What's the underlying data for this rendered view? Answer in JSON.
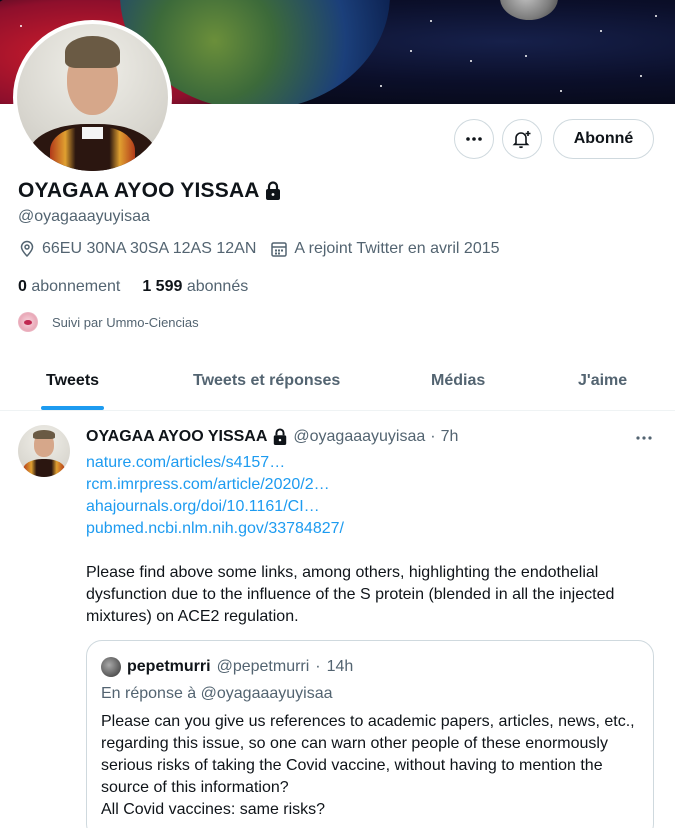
{
  "profile": {
    "name": "OYAGAA AYOO YISSAA",
    "handle": "@oyagaaayuyisaa",
    "location": "66EU 30NA 30SA 12AS 12AN",
    "joined": "A rejoint Twitter en avril 2015",
    "following_count": "0",
    "following_label": "abonnement",
    "followers_count": "1 599",
    "followers_label": "abonnés",
    "followed_by": "Suivi par Ummo-Ciencias"
  },
  "actions": {
    "more_icon": "more-horizontal-icon",
    "notify_icon": "bell-plus-icon",
    "follow_label": "Abonné"
  },
  "tabs": [
    {
      "label": "Tweets"
    },
    {
      "label": "Tweets et réponses"
    },
    {
      "label": "Médias"
    },
    {
      "label": "J'aime"
    }
  ],
  "tweet": {
    "author_name": "OYAGAA AYOO YISSAA",
    "author_handle": "@oyagaaayuyisaa",
    "separator": "·",
    "time": "7h",
    "links": [
      "nature.com/articles/s4157…",
      "rcm.imrpress.com/article/2020/2…",
      "ahajournals.org/doi/10.1161/CI…",
      "pubmed.ncbi.nlm.nih.gov/33784827/"
    ],
    "text": "Please find above some links, among others, highlighting the endothelial dysfunction due to the influence of the S protein (blended in all the injected mixtures) on ACE2 regulation.",
    "quote": {
      "author_name": "pepetmurri",
      "author_handle": "@pepetmurri",
      "separator": "·",
      "time": "14h",
      "reply_to": "En réponse à @oyagaaayuyisaa",
      "text": "Please can you give us references to academic papers, articles, news, etc., regarding this issue, so one can warn other people of these enormously serious risks of taking the Covid vaccine, without having to mention the source of this information?",
      "text2": "All Covid vaccines: same risks?"
    }
  },
  "colors": {
    "accent": "#1d9bf0",
    "secondary_text": "#536471",
    "border": "#cfd9de"
  }
}
